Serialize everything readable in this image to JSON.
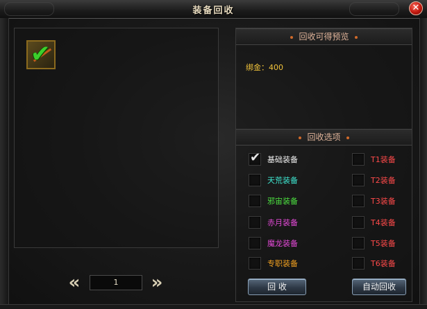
{
  "window": {
    "title": "装备回收"
  },
  "left": {
    "pager": {
      "page": "1"
    }
  },
  "preview": {
    "header": "回收可得预览",
    "text": "绑金：400"
  },
  "options": {
    "header": "回收选项",
    "left_col": [
      {
        "label": "基础装备",
        "color": "#f0f0f0",
        "checked": true
      },
      {
        "label": "天荒装备",
        "color": "#3ee6d0",
        "checked": false
      },
      {
        "label": "邪宙装备",
        "color": "#4ce040",
        "checked": false
      },
      {
        "label": "赤月装备",
        "color": "#e44ad8",
        "checked": false
      },
      {
        "label": "魔龙装备",
        "color": "#e44ad8",
        "checked": false
      },
      {
        "label": "专职装备",
        "color": "#f0a020",
        "checked": false
      }
    ],
    "right_col": [
      {
        "label": "T1装备",
        "color": "#ff4a4a",
        "checked": false
      },
      {
        "label": "T2装备",
        "color": "#ff4a4a",
        "checked": false
      },
      {
        "label": "T3装备",
        "color": "#ff4a4a",
        "checked": false
      },
      {
        "label": "T4装备",
        "color": "#ff4a4a",
        "checked": false
      },
      {
        "label": "T5装备",
        "color": "#ff4a4a",
        "checked": false
      },
      {
        "label": "T6装备",
        "color": "#ff4a4a",
        "checked": false
      }
    ]
  },
  "buttons": {
    "recycle": "回 收",
    "auto_recycle": "自动回收"
  }
}
